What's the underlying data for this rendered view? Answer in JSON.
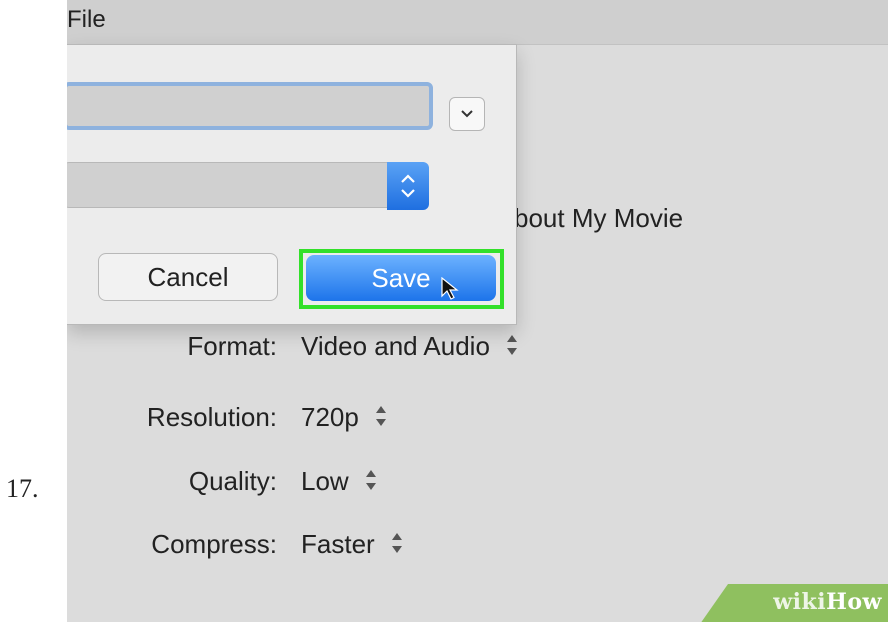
{
  "step": {
    "number": "17."
  },
  "menubar": {
    "file_label": "File"
  },
  "dialog": {
    "cancel_label": "Cancel",
    "save_label": "Save"
  },
  "export": {
    "filename_partial": "bout My Movie",
    "settings": [
      {
        "label": "Format:",
        "value": "Video and Audio"
      },
      {
        "label": "Resolution:",
        "value": "720p"
      },
      {
        "label": "Quality:",
        "value": "Low"
      },
      {
        "label": "Compress:",
        "value": "Faster"
      }
    ]
  },
  "watermark": {
    "wiki": "wiki",
    "how": "How"
  },
  "colors": {
    "save_button": "#1d74ea",
    "highlight": "#33e02a",
    "watermark": "#8fc05f"
  }
}
